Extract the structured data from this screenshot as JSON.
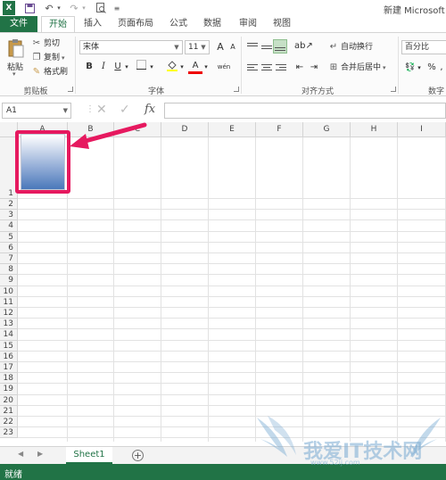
{
  "title_bar": {
    "app_title": "新建 Microsoft E",
    "quick_access": [
      "excel-logo-icon",
      "save-icon",
      "undo-icon",
      "redo-icon",
      "print-preview-icon",
      "customize-icon"
    ]
  },
  "tabs": [
    {
      "label": "文件"
    },
    {
      "label": "开始"
    },
    {
      "label": "插入"
    },
    {
      "label": "页面布局"
    },
    {
      "label": "公式"
    },
    {
      "label": "数据"
    },
    {
      "label": "审阅"
    },
    {
      "label": "视图"
    }
  ],
  "ribbon": {
    "clipboard": {
      "paste_label": "粘贴",
      "cut_label": "剪切",
      "copy_label": "复制",
      "format_painter_label": "格式刷",
      "group_label": "剪贴板"
    },
    "font": {
      "font_name": "宋体",
      "font_size": "11",
      "grow_label": "A",
      "shrink_label": "A",
      "bold_label": "B",
      "italic_label": "I",
      "underline_label": "U",
      "font_color_label": "A",
      "wen_label": "wén",
      "group_label": "字体"
    },
    "alignment": {
      "wrap_text_label": "自动换行",
      "merge_center_label": "合并后居中",
      "group_label": "对齐方式"
    },
    "number": {
      "format_value": "百分比",
      "group_label": "数字",
      "percent_label": "%",
      "comma_label": ","
    }
  },
  "formula_bar": {
    "name_box": "A1",
    "fx_label": "fx",
    "cancel_label": "✕",
    "enter_label": "✓"
  },
  "grid": {
    "columns": [
      "A",
      "B",
      "C",
      "D",
      "E",
      "F",
      "G",
      "H",
      "I"
    ],
    "rows": [
      "1",
      "2",
      "3",
      "4",
      "5",
      "6",
      "7",
      "8",
      "9",
      "10",
      "11",
      "12",
      "13",
      "14",
      "15",
      "16",
      "17",
      "18",
      "19",
      "20",
      "21",
      "22",
      "23"
    ]
  },
  "sheets": {
    "active": "Sheet1",
    "nav_prev": "◀",
    "nav_next": "▶",
    "add_label": "+"
  },
  "status": {
    "text": "就绪"
  },
  "watermark": {
    "text": "我爱IT技术网",
    "sub": "www.52ij.com"
  },
  "colors": {
    "excel_green": "#217346",
    "highlight": "#e6195f",
    "gradient_top": "#ffffff",
    "gradient_bottom": "#4a78ba"
  }
}
